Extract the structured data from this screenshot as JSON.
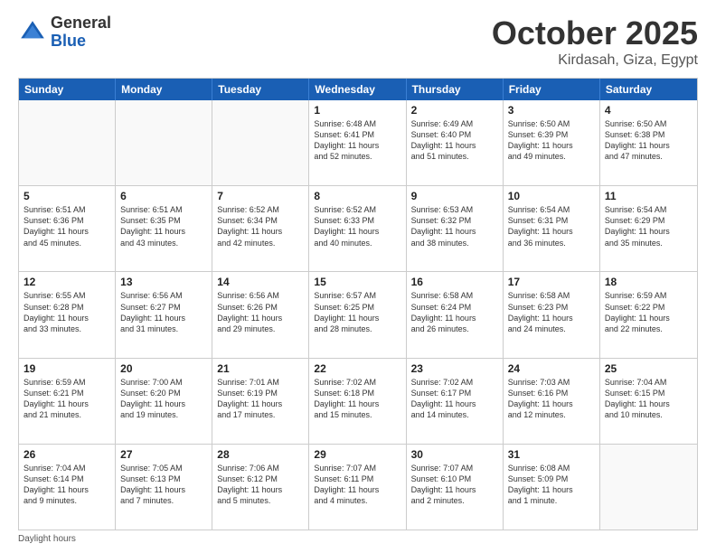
{
  "logo": {
    "general": "General",
    "blue": "Blue"
  },
  "title": {
    "month": "October 2025",
    "location": "Kirdasah, Giza, Egypt"
  },
  "header_days": [
    "Sunday",
    "Monday",
    "Tuesday",
    "Wednesday",
    "Thursday",
    "Friday",
    "Saturday"
  ],
  "weeks": [
    [
      {
        "day": "",
        "info": ""
      },
      {
        "day": "",
        "info": ""
      },
      {
        "day": "",
        "info": ""
      },
      {
        "day": "1",
        "info": "Sunrise: 6:48 AM\nSunset: 6:41 PM\nDaylight: 11 hours\nand 52 minutes."
      },
      {
        "day": "2",
        "info": "Sunrise: 6:49 AM\nSunset: 6:40 PM\nDaylight: 11 hours\nand 51 minutes."
      },
      {
        "day": "3",
        "info": "Sunrise: 6:50 AM\nSunset: 6:39 PM\nDaylight: 11 hours\nand 49 minutes."
      },
      {
        "day": "4",
        "info": "Sunrise: 6:50 AM\nSunset: 6:38 PM\nDaylight: 11 hours\nand 47 minutes."
      }
    ],
    [
      {
        "day": "5",
        "info": "Sunrise: 6:51 AM\nSunset: 6:36 PM\nDaylight: 11 hours\nand 45 minutes."
      },
      {
        "day": "6",
        "info": "Sunrise: 6:51 AM\nSunset: 6:35 PM\nDaylight: 11 hours\nand 43 minutes."
      },
      {
        "day": "7",
        "info": "Sunrise: 6:52 AM\nSunset: 6:34 PM\nDaylight: 11 hours\nand 42 minutes."
      },
      {
        "day": "8",
        "info": "Sunrise: 6:52 AM\nSunset: 6:33 PM\nDaylight: 11 hours\nand 40 minutes."
      },
      {
        "day": "9",
        "info": "Sunrise: 6:53 AM\nSunset: 6:32 PM\nDaylight: 11 hours\nand 38 minutes."
      },
      {
        "day": "10",
        "info": "Sunrise: 6:54 AM\nSunset: 6:31 PM\nDaylight: 11 hours\nand 36 minutes."
      },
      {
        "day": "11",
        "info": "Sunrise: 6:54 AM\nSunset: 6:29 PM\nDaylight: 11 hours\nand 35 minutes."
      }
    ],
    [
      {
        "day": "12",
        "info": "Sunrise: 6:55 AM\nSunset: 6:28 PM\nDaylight: 11 hours\nand 33 minutes."
      },
      {
        "day": "13",
        "info": "Sunrise: 6:56 AM\nSunset: 6:27 PM\nDaylight: 11 hours\nand 31 minutes."
      },
      {
        "day": "14",
        "info": "Sunrise: 6:56 AM\nSunset: 6:26 PM\nDaylight: 11 hours\nand 29 minutes."
      },
      {
        "day": "15",
        "info": "Sunrise: 6:57 AM\nSunset: 6:25 PM\nDaylight: 11 hours\nand 28 minutes."
      },
      {
        "day": "16",
        "info": "Sunrise: 6:58 AM\nSunset: 6:24 PM\nDaylight: 11 hours\nand 26 minutes."
      },
      {
        "day": "17",
        "info": "Sunrise: 6:58 AM\nSunset: 6:23 PM\nDaylight: 11 hours\nand 24 minutes."
      },
      {
        "day": "18",
        "info": "Sunrise: 6:59 AM\nSunset: 6:22 PM\nDaylight: 11 hours\nand 22 minutes."
      }
    ],
    [
      {
        "day": "19",
        "info": "Sunrise: 6:59 AM\nSunset: 6:21 PM\nDaylight: 11 hours\nand 21 minutes."
      },
      {
        "day": "20",
        "info": "Sunrise: 7:00 AM\nSunset: 6:20 PM\nDaylight: 11 hours\nand 19 minutes."
      },
      {
        "day": "21",
        "info": "Sunrise: 7:01 AM\nSunset: 6:19 PM\nDaylight: 11 hours\nand 17 minutes."
      },
      {
        "day": "22",
        "info": "Sunrise: 7:02 AM\nSunset: 6:18 PM\nDaylight: 11 hours\nand 15 minutes."
      },
      {
        "day": "23",
        "info": "Sunrise: 7:02 AM\nSunset: 6:17 PM\nDaylight: 11 hours\nand 14 minutes."
      },
      {
        "day": "24",
        "info": "Sunrise: 7:03 AM\nSunset: 6:16 PM\nDaylight: 11 hours\nand 12 minutes."
      },
      {
        "day": "25",
        "info": "Sunrise: 7:04 AM\nSunset: 6:15 PM\nDaylight: 11 hours\nand 10 minutes."
      }
    ],
    [
      {
        "day": "26",
        "info": "Sunrise: 7:04 AM\nSunset: 6:14 PM\nDaylight: 11 hours\nand 9 minutes."
      },
      {
        "day": "27",
        "info": "Sunrise: 7:05 AM\nSunset: 6:13 PM\nDaylight: 11 hours\nand 7 minutes."
      },
      {
        "day": "28",
        "info": "Sunrise: 7:06 AM\nSunset: 6:12 PM\nDaylight: 11 hours\nand 5 minutes."
      },
      {
        "day": "29",
        "info": "Sunrise: 7:07 AM\nSunset: 6:11 PM\nDaylight: 11 hours\nand 4 minutes."
      },
      {
        "day": "30",
        "info": "Sunrise: 7:07 AM\nSunset: 6:10 PM\nDaylight: 11 hours\nand 2 minutes."
      },
      {
        "day": "31",
        "info": "Sunrise: 6:08 AM\nSunset: 5:09 PM\nDaylight: 11 hours\nand 1 minute."
      },
      {
        "day": "",
        "info": ""
      }
    ]
  ],
  "footer": {
    "daylight_label": "Daylight hours"
  }
}
